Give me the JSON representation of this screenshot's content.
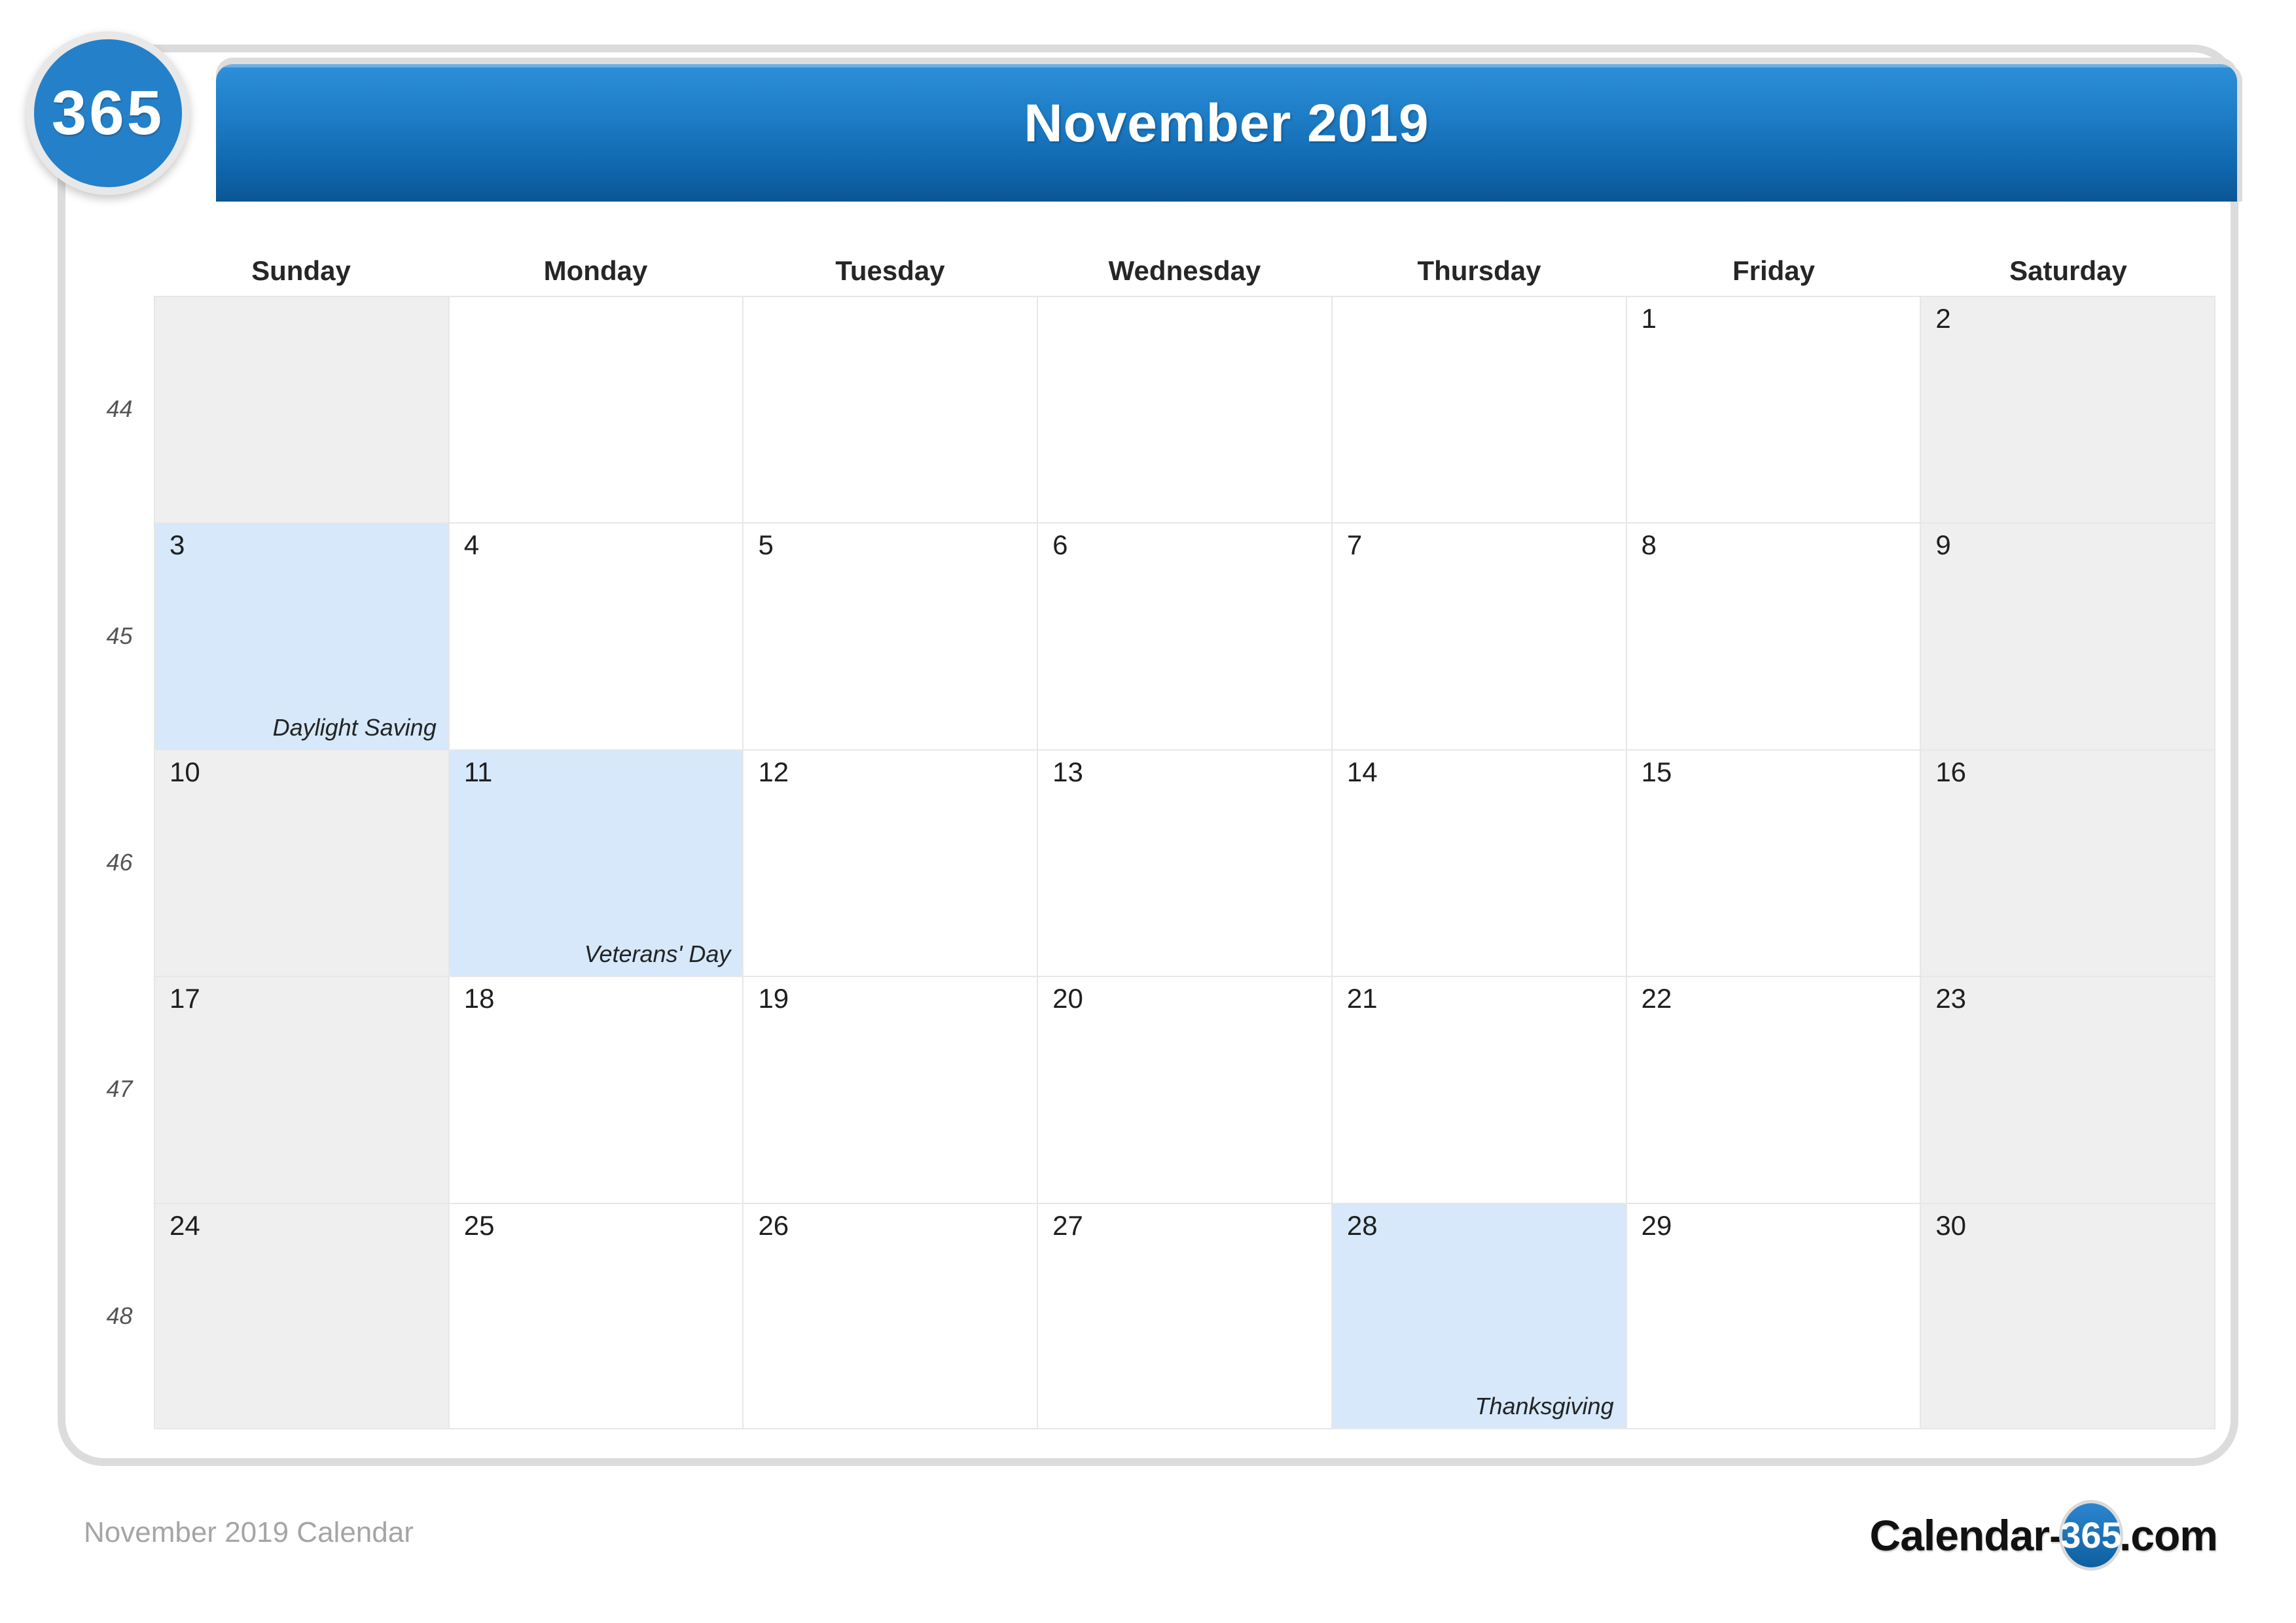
{
  "header": {
    "title": "November 2019",
    "badge_label": "365"
  },
  "weekdays": [
    "Sunday",
    "Monday",
    "Tuesday",
    "Wednesday",
    "Thursday",
    "Friday",
    "Saturday"
  ],
  "weeks": [
    {
      "week_number": "44",
      "days": [
        {
          "num": "",
          "event": "",
          "type": "empty-weekend"
        },
        {
          "num": "",
          "event": "",
          "type": "empty"
        },
        {
          "num": "",
          "event": "",
          "type": "empty"
        },
        {
          "num": "",
          "event": "",
          "type": "empty"
        },
        {
          "num": "",
          "event": "",
          "type": "empty"
        },
        {
          "num": "1",
          "event": "",
          "type": "normal"
        },
        {
          "num": "2",
          "event": "",
          "type": "weekend"
        }
      ]
    },
    {
      "week_number": "45",
      "days": [
        {
          "num": "3",
          "event": "Daylight Saving",
          "type": "holiday"
        },
        {
          "num": "4",
          "event": "",
          "type": "normal"
        },
        {
          "num": "5",
          "event": "",
          "type": "normal"
        },
        {
          "num": "6",
          "event": "",
          "type": "normal"
        },
        {
          "num": "7",
          "event": "",
          "type": "normal"
        },
        {
          "num": "8",
          "event": "",
          "type": "normal"
        },
        {
          "num": "9",
          "event": "",
          "type": "weekend"
        }
      ]
    },
    {
      "week_number": "46",
      "days": [
        {
          "num": "10",
          "event": "",
          "type": "weekend"
        },
        {
          "num": "11",
          "event": "Veterans' Day",
          "type": "holiday"
        },
        {
          "num": "12",
          "event": "",
          "type": "normal"
        },
        {
          "num": "13",
          "event": "",
          "type": "normal"
        },
        {
          "num": "14",
          "event": "",
          "type": "normal"
        },
        {
          "num": "15",
          "event": "",
          "type": "normal"
        },
        {
          "num": "16",
          "event": "",
          "type": "weekend"
        }
      ]
    },
    {
      "week_number": "47",
      "days": [
        {
          "num": "17",
          "event": "",
          "type": "weekend"
        },
        {
          "num": "18",
          "event": "",
          "type": "normal"
        },
        {
          "num": "19",
          "event": "",
          "type": "normal"
        },
        {
          "num": "20",
          "event": "",
          "type": "normal"
        },
        {
          "num": "21",
          "event": "",
          "type": "normal"
        },
        {
          "num": "22",
          "event": "",
          "type": "normal"
        },
        {
          "num": "23",
          "event": "",
          "type": "weekend"
        }
      ]
    },
    {
      "week_number": "48",
      "days": [
        {
          "num": "24",
          "event": "",
          "type": "weekend"
        },
        {
          "num": "25",
          "event": "",
          "type": "normal"
        },
        {
          "num": "26",
          "event": "",
          "type": "normal"
        },
        {
          "num": "27",
          "event": "",
          "type": "normal"
        },
        {
          "num": "28",
          "event": "Thanksgiving",
          "type": "holiday"
        },
        {
          "num": "29",
          "event": "",
          "type": "normal"
        },
        {
          "num": "30",
          "event": "",
          "type": "weekend"
        }
      ]
    }
  ],
  "watermark": {
    "text": "365"
  },
  "footer": {
    "caption": "November 2019 Calendar",
    "logo_prefix": "Calendar-",
    "logo_badge": "365",
    "logo_suffix": ".com"
  },
  "colors": {
    "header_top": "#2e90da",
    "header_bottom": "#0a5694",
    "badge_blue": "#2480c8",
    "weekend_gray": "#efefef",
    "holiday_blue": "#d6e8fa",
    "grid_line": "#e7e7e7",
    "card_border": "#dcdcdc",
    "footer_text": "#a5a5a5"
  }
}
